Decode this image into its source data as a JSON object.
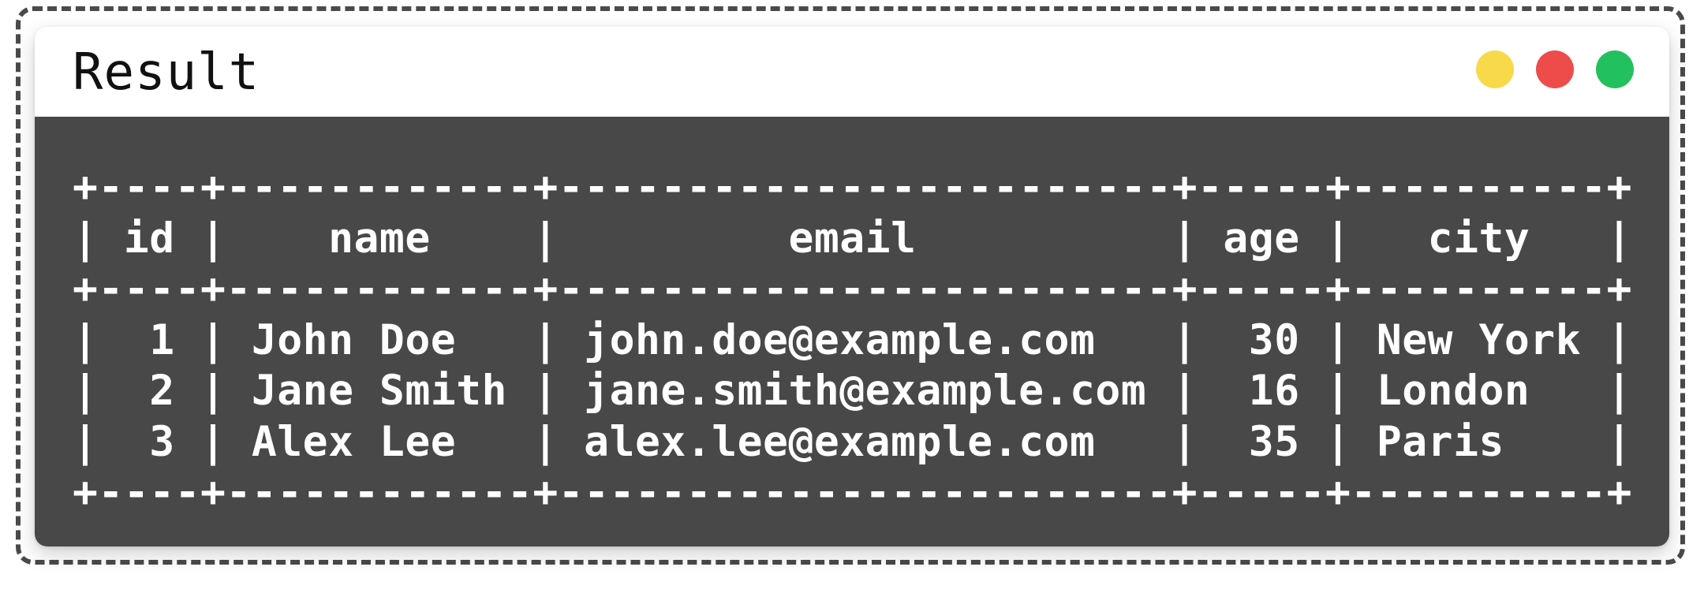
{
  "window": {
    "title": "Result",
    "controls": {
      "yellow": "#f7d94a",
      "red": "#ee4b4b",
      "green": "#22c15e"
    }
  },
  "colors": {
    "frame_border": "#4a4a4a",
    "terminal_bg": "#484848",
    "terminal_text": "#ffffff"
  },
  "table": {
    "lines": [
      "+----+------------+------------------------+-----+----------+",
      "| id |    name    |         email          | age |   city   |",
      "+----+------------+------------------------+-----+----------+",
      "|  1 | John Doe   | john.doe@example.com   |  30 | New York |",
      "|  2 | Jane Smith | jane.smith@example.com |  16 | London   |",
      "|  3 | Alex Lee   | alex.lee@example.com   |  35 | Paris    |",
      "+----+------------+------------------------+-----+----------+"
    ],
    "columns": [
      "id",
      "name",
      "email",
      "age",
      "city"
    ],
    "rows": [
      [
        "1",
        "John Doe",
        "john.doe@example.com",
        "30",
        "New York"
      ],
      [
        "2",
        "Jane Smith",
        "jane.smith@example.com",
        "16",
        "London"
      ],
      [
        "3",
        "Alex Lee",
        "alex.lee@example.com",
        "35",
        "Paris"
      ]
    ]
  }
}
